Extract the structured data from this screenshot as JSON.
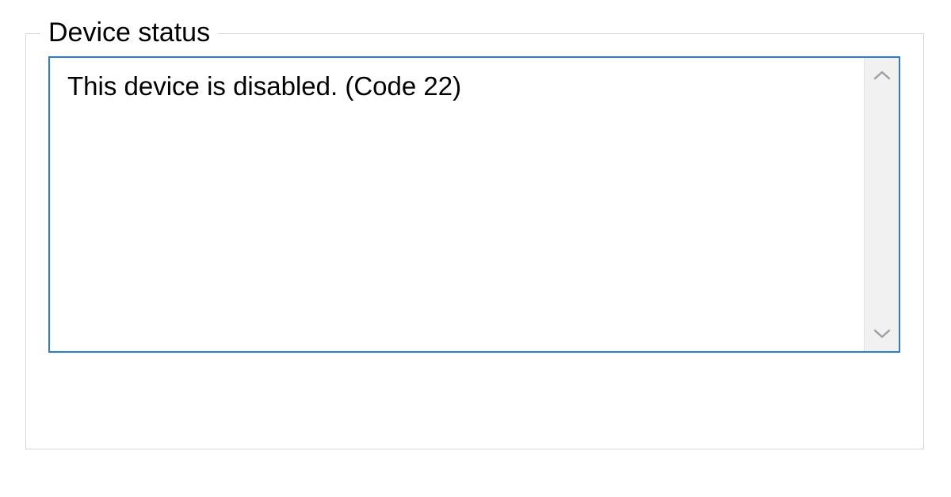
{
  "groupbox": {
    "legend": "Device status"
  },
  "status": {
    "message": "This device is disabled. (Code 22)"
  }
}
